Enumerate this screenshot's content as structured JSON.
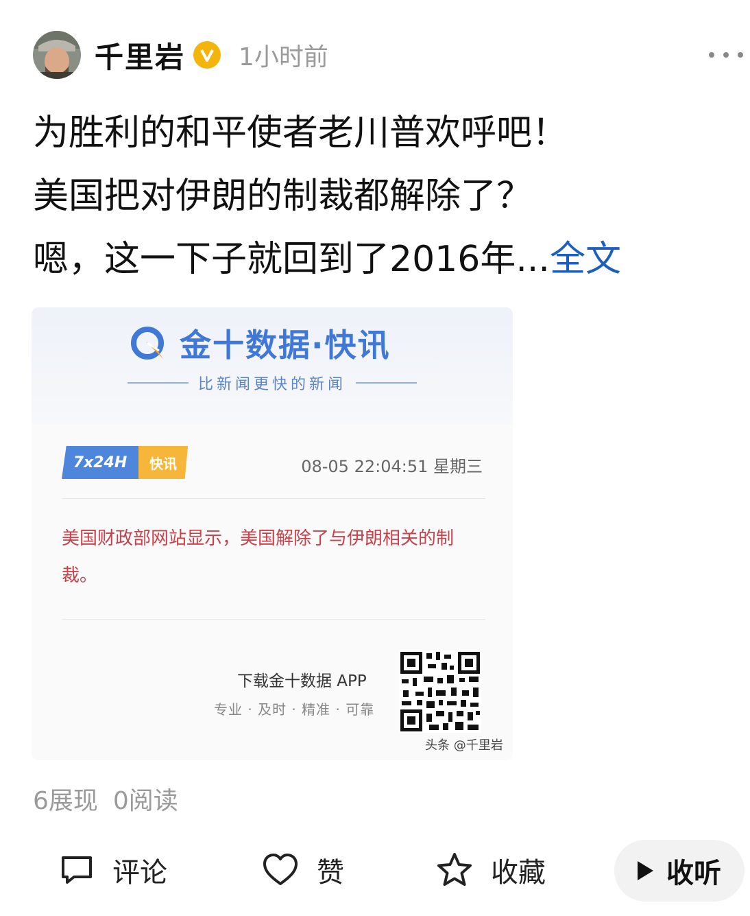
{
  "post": {
    "author": "千里岩",
    "time": "1小时前",
    "lines": [
      "为胜利的和平使者老川普欢呼吧！",
      "美国把对伊朗的制裁都解除了？",
      "嗯，这一下子就回到了2016年..."
    ],
    "full_text_link": "全文"
  },
  "card": {
    "logo": "金十数据·快讯",
    "slogan": "比新闻更快的新闻",
    "badge_left": "7x24H",
    "badge_right": "快讯",
    "datetime": "08-05 22:04:51 星期三",
    "news": "美国财政部网站显示，美国解除了与伊朗相关的制裁。",
    "download_title": "下载金十数据 APP",
    "download_sub": "专业 · 及时 · 精准 · 可靠",
    "watermark": "头条 @千里岩"
  },
  "stats": {
    "views": "6展现",
    "reads": "0阅读"
  },
  "actions": {
    "comment": "评论",
    "like": "赞",
    "favorite": "收藏",
    "listen": "收听"
  },
  "colors": {
    "link": "#1d5fbf",
    "brand_blue": "#3f78d6",
    "news_red": "#c8414a",
    "verified": "#f3b50c"
  }
}
